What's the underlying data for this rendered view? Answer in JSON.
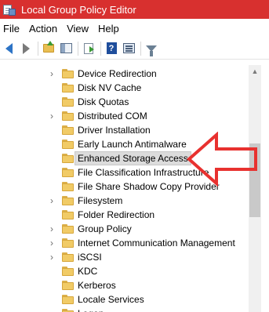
{
  "window": {
    "title": "Local Group Policy Editor"
  },
  "menu": [
    "File",
    "Action",
    "View",
    "Help"
  ],
  "toolbar": {
    "icons": [
      "back-icon",
      "forward-icon",
      "up-folder-icon",
      "show-hide-console-tree-icon",
      "export-list-icon",
      "help-icon",
      "properties-icon",
      "filter-icon"
    ],
    "help_glyph": "?"
  },
  "tree": {
    "items": [
      {
        "label": "Device Redirection",
        "expandable": true
      },
      {
        "label": "Disk NV Cache",
        "expandable": false
      },
      {
        "label": "Disk Quotas",
        "expandable": false
      },
      {
        "label": "Distributed COM",
        "expandable": true
      },
      {
        "label": "Driver Installation",
        "expandable": false
      },
      {
        "label": "Early Launch Antimalware",
        "expandable": false
      },
      {
        "label": "Enhanced Storage Access",
        "expandable": false,
        "selected": true
      },
      {
        "label": "File Classification Infrastructure",
        "expandable": false
      },
      {
        "label": "File Share Shadow Copy Provider",
        "expandable": false
      },
      {
        "label": "Filesystem",
        "expandable": true
      },
      {
        "label": "Folder Redirection",
        "expandable": false
      },
      {
        "label": "Group Policy",
        "expandable": true
      },
      {
        "label": "Internet Communication Management",
        "expandable": true
      },
      {
        "label": "iSCSI",
        "expandable": true
      },
      {
        "label": "KDC",
        "expandable": false
      },
      {
        "label": "Kerberos",
        "expandable": false
      },
      {
        "label": "Locale Services",
        "expandable": false
      },
      {
        "label": "Logon",
        "expandable": false
      }
    ]
  },
  "annotation": {
    "arrow_color": "#e8312f",
    "points_to": "Enhanced Storage Access"
  },
  "colors": {
    "titlebar": "#d8302f",
    "folder": "#f1cb66"
  }
}
